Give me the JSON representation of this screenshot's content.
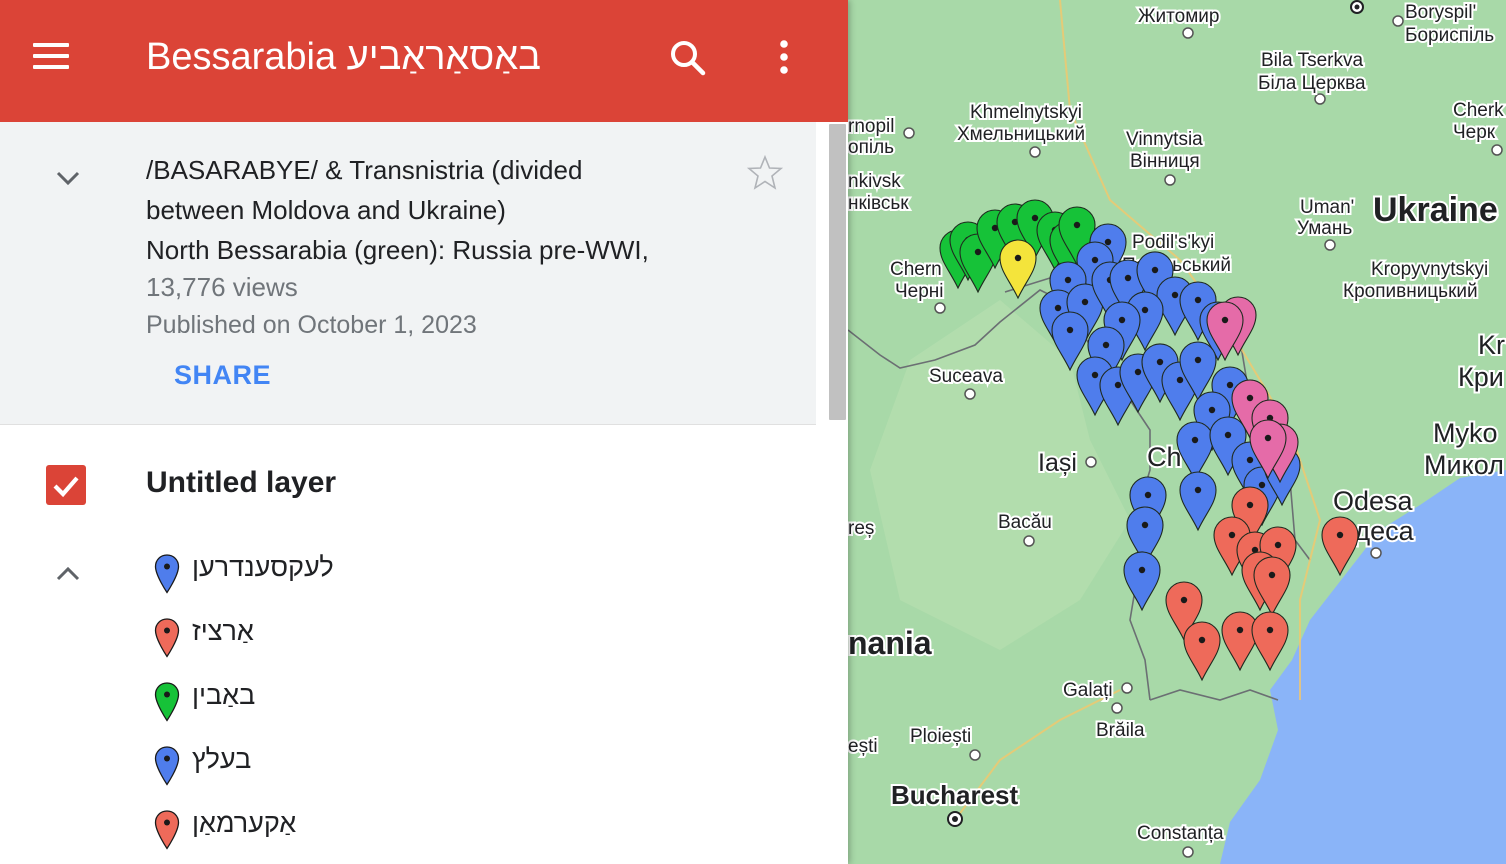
{
  "header": {
    "title": "Bessarabia באַסאַראַביע"
  },
  "info": {
    "description_lines": [
      "/BASARABYE/ & Transnistria (divided",
      "between Moldova and Ukraine)",
      "North Bessarabia (green): Russia pre-WWI,"
    ],
    "views": "13,776 views",
    "published": "Published on October 1, 2023",
    "share_label": "SHARE"
  },
  "layer": {
    "name": "Untitled layer",
    "checked": true,
    "items": [
      {
        "label": "לעקסענדרען",
        "color": "#4f7dec"
      },
      {
        "label": "אַרציז",
        "color": "#ee6a5a"
      },
      {
        "label": "באַבין",
        "color": "#16c238"
      },
      {
        "label": "בעלץ",
        "color": "#4f7dec"
      },
      {
        "label": "אַקערמאַן",
        "color": "#ee6a5a"
      }
    ]
  },
  "map": {
    "land_color": "#a8d9a8",
    "sea_color": "#8ab4f8",
    "labels": {
      "zhytomyr": "Житомир",
      "boryspil_lat": "Boryspil'",
      "boryspil_cyr": "Бориспіль",
      "bila_lat": "Bila Tserkva",
      "bila_cyr": "Біла Церква",
      "ternopil_lat": "rnopil",
      "ternopil_cyr": "опіль",
      "khmel_lat": "Khmelnytskyi",
      "khmel_cyr": "Хмельницький",
      "vinn_lat": "Vinnytsia",
      "vinn_cyr": "Вінниця",
      "cherk_lat": "Cherk",
      "cherk_cyr": "Черк",
      "kivsk_lat": "nkivsk",
      "kivsk_cyr": "нківськ",
      "uman_lat": "Uman'",
      "uman_cyr": "Умань",
      "ukraine": "Ukraine",
      "podil_lat": "Podil's'kyi",
      "podil_cyr": "Подільський",
      "chern_lat": "Chern",
      "chern_cyr": "Черні",
      "kropy_lat": "Kropyvnytskyi",
      "kropy_cyr": "Кропивницький",
      "kr_lat": "Kr",
      "kr_cyr": "Кри",
      "suceava": "Suceava",
      "myko_lat": "Myko",
      "myko_cyr": "Микол",
      "iasi": "Iași",
      "chi": "Ch",
      "odesa_lat": "Odesa",
      "odesa_cyr": "Одеса",
      "res": "reș",
      "bacau": "Bacău",
      "romania": "nania",
      "galati": "Galați",
      "ploiesti": "Ploiești",
      "braila": "Brăila",
      "sti": "ești",
      "bucharest": "Bucharest",
      "constanta": "Constanța"
    }
  }
}
